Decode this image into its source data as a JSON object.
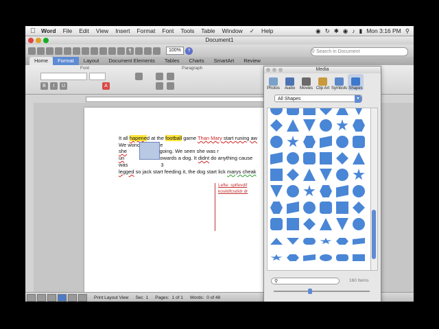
{
  "menubar": {
    "apple": "",
    "app_name": "Word",
    "items": [
      "File",
      "Edit",
      "View",
      "Insert",
      "Format",
      "Font",
      "Tools",
      "Table",
      "Window",
      "Help"
    ],
    "clock": "Mon 3:16 PM"
  },
  "window": {
    "title": "Document1"
  },
  "toolbar": {
    "zoom": "100%",
    "search_placeholder": "Search in Document"
  },
  "ribbon": {
    "tabs": [
      "Home",
      "Format",
      "Layout",
      "Document Elements",
      "Tables",
      "Charts",
      "SmartArt",
      "Review"
    ],
    "groups": {
      "font": "Font",
      "paragraph": "Paragraph"
    }
  },
  "document": {
    "line1_a": "It all ",
    "line1_b": "hapene",
    "line1_c": "d at the ",
    "line1_d": "football",
    "line1_e": " game ",
    "line1_f": "Than Mary",
    "line1_g": " start runing aw",
    "line2": "We wondered were",
    "line3_a": "she",
    "line3_b": "is going. We seen she was r",
    "line4_a": "un",
    "line4_b": "towards a dog. It ",
    "line4_c": "didnt",
    "line4_d": " do anything cause",
    "line5_a": "was",
    "line5_b": "3",
    "line6_a": "legged",
    "line6_b": " so jack start feeding it, the dog start lick ",
    "line6_c": "marys cheak",
    "comment1": "Lefte: sptfevdif",
    "comment2": "koslidfcsdidr dr"
  },
  "statusbar": {
    "view": "Print Layout View",
    "sec_label": "Sec",
    "sec_value": "1",
    "pages_label": "Pages:",
    "pages_value": "1 of 1",
    "words_label": "Words:",
    "words_value": "0 of 48"
  },
  "media": {
    "title": "Media",
    "tabs": [
      "Photos",
      "Audio",
      "Movies",
      "Clip Art",
      "Symbols",
      "Shapes"
    ],
    "selected_tab": "Shapes",
    "dropdown": "All Shapes",
    "item_count": "160 Items",
    "shape_color": "#4a86d6"
  }
}
